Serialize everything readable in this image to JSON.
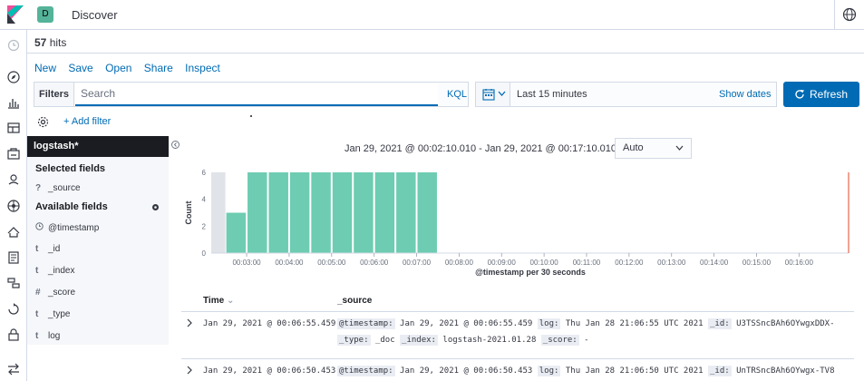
{
  "header": {
    "space_initial": "D",
    "app_title": "Discover"
  },
  "hits": {
    "count": "57",
    "label": "hits"
  },
  "topnav": [
    "New",
    "Save",
    "Open",
    "Share",
    "Inspect"
  ],
  "query": {
    "filters_label": "Filters",
    "search_placeholder": "Search",
    "language": "KQL"
  },
  "datepicker": {
    "range": "Last 15 minutes",
    "show_dates": "Show dates"
  },
  "refresh": {
    "label": "Refresh"
  },
  "filter_bar": {
    "add_filter": "+ Add filter"
  },
  "sidebar": {
    "index_pattern": "logstash*",
    "selected_heading": "Selected fields",
    "selected_fields": [
      {
        "type": "?",
        "name": "_source"
      }
    ],
    "available_heading": "Available fields",
    "available_fields": [
      {
        "type": "clock",
        "name": "@timestamp"
      },
      {
        "type": "t",
        "name": "_id"
      },
      {
        "type": "t",
        "name": "_index"
      },
      {
        "type": "#",
        "name": "_score"
      },
      {
        "type": "t",
        "name": "_type"
      },
      {
        "type": "t",
        "name": "log"
      }
    ]
  },
  "chart_header": {
    "time_range": "Jan 29, 2021 @ 00:02:10.010 - Jan 29, 2021 @ 00:17:10.010 —",
    "interval": "Auto"
  },
  "chart_data": {
    "type": "bar",
    "x_label": "@timestamp per 30 seconds",
    "y_label": "Count",
    "ylim": [
      0,
      6
    ],
    "y_ticks": [
      "0",
      "2",
      "4",
      "6"
    ],
    "x_ticks": [
      "00:03:00",
      "00:04:00",
      "00:05:00",
      "00:06:00",
      "00:07:00",
      "00:08:00",
      "00:09:00",
      "00:10:00",
      "00:11:00",
      "00:12:00",
      "00:13:00",
      "00:14:00",
      "00:15:00",
      "00:16:00"
    ],
    "x_start_minute": 2.1667,
    "x_end_minute": 17.1667,
    "bars": [
      {
        "start_minute": 2.5,
        "value": 3
      },
      {
        "start_minute": 3.0,
        "value": 6
      },
      {
        "start_minute": 3.5,
        "value": 6
      },
      {
        "start_minute": 4.0,
        "value": 6
      },
      {
        "start_minute": 4.5,
        "value": 6
      },
      {
        "start_minute": 5.0,
        "value": 6
      },
      {
        "start_minute": 5.5,
        "value": 6
      },
      {
        "start_minute": 6.0,
        "value": 6
      },
      {
        "start_minute": 6.5,
        "value": 6
      },
      {
        "start_minute": 7.0,
        "value": 6
      }
    ],
    "bar_color": "#6dccb1",
    "partial_bucket_color": "#e0e3e8",
    "current_time_color": "#e7664c"
  },
  "table": {
    "time_header": "Time",
    "source_header": "_source",
    "rows": [
      {
        "time": "Jan 29, 2021 @ 00:06:55.459",
        "line1": [
          {
            "k": "@timestamp:",
            "v": "Jan 29, 2021 @ 00:06:55.459"
          },
          {
            "k": "log:",
            "v": "Thu Jan 28 21:06:55 UTC 2021"
          },
          {
            "k": "_id:",
            "v": "U3TSSncBAh6OYwgxDDX-"
          }
        ],
        "line2": [
          {
            "k": "_type:",
            "v": "_doc"
          },
          {
            "k": "_index:",
            "v": "logstash-2021.01.28"
          },
          {
            "k": "_score:",
            "v": "-"
          }
        ]
      },
      {
        "time": "Jan 29, 2021 @ 00:06:50.453",
        "line1": [
          {
            "k": "@timestamp:",
            "v": "Jan 29, 2021 @ 00:06:50.453"
          },
          {
            "k": "log:",
            "v": "Thu Jan 28 21:06:50 UTC 2021"
          },
          {
            "k": "_id:",
            "v": "UnTRSncBAh6OYwgx-TV8"
          }
        ],
        "line2": []
      }
    ]
  }
}
